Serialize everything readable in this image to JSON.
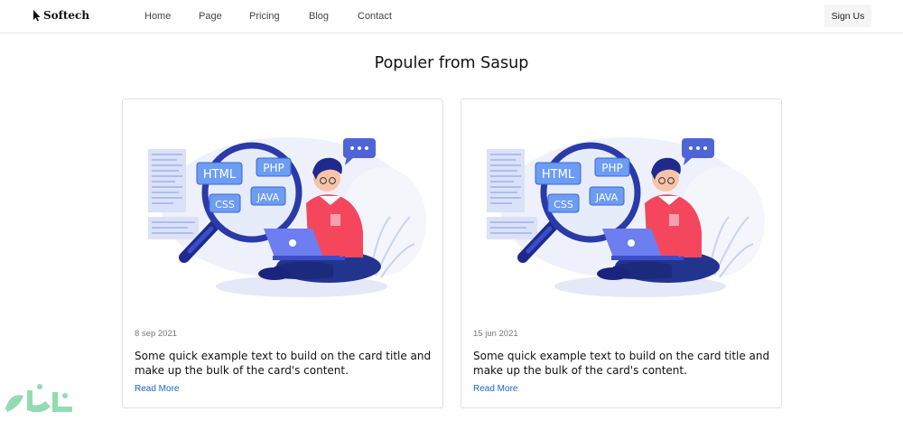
{
  "brand": {
    "name": "Softech",
    "icon": "cursor-icon"
  },
  "nav": {
    "items": [
      "Home",
      "Page",
      "Pricing",
      "Blog",
      "Contact"
    ],
    "signup_label": "Sign Us"
  },
  "section": {
    "title": "Populer from Sasup"
  },
  "cards": [
    {
      "date": "8 sep 2021",
      "text": "Some quick example text to build on the card title and make up the bulk of the card's content.",
      "link": "Read More",
      "illustration_tags": [
        "HTML",
        "PHP",
        "CSS",
        "JAVA"
      ]
    },
    {
      "date": "15 jun 2021",
      "text": "Some quick example text to build on the card title and make up the bulk of the card's content.",
      "link": "Read More",
      "illustration_tags": [
        "HTML",
        "PHP",
        "CSS",
        "JAVA"
      ]
    }
  ],
  "colors": {
    "accent": "#1a66c6",
    "illustration_blue": "#3b4dc8",
    "illustration_red": "#f4475e",
    "tag_blue": "#5d8ff0"
  }
}
